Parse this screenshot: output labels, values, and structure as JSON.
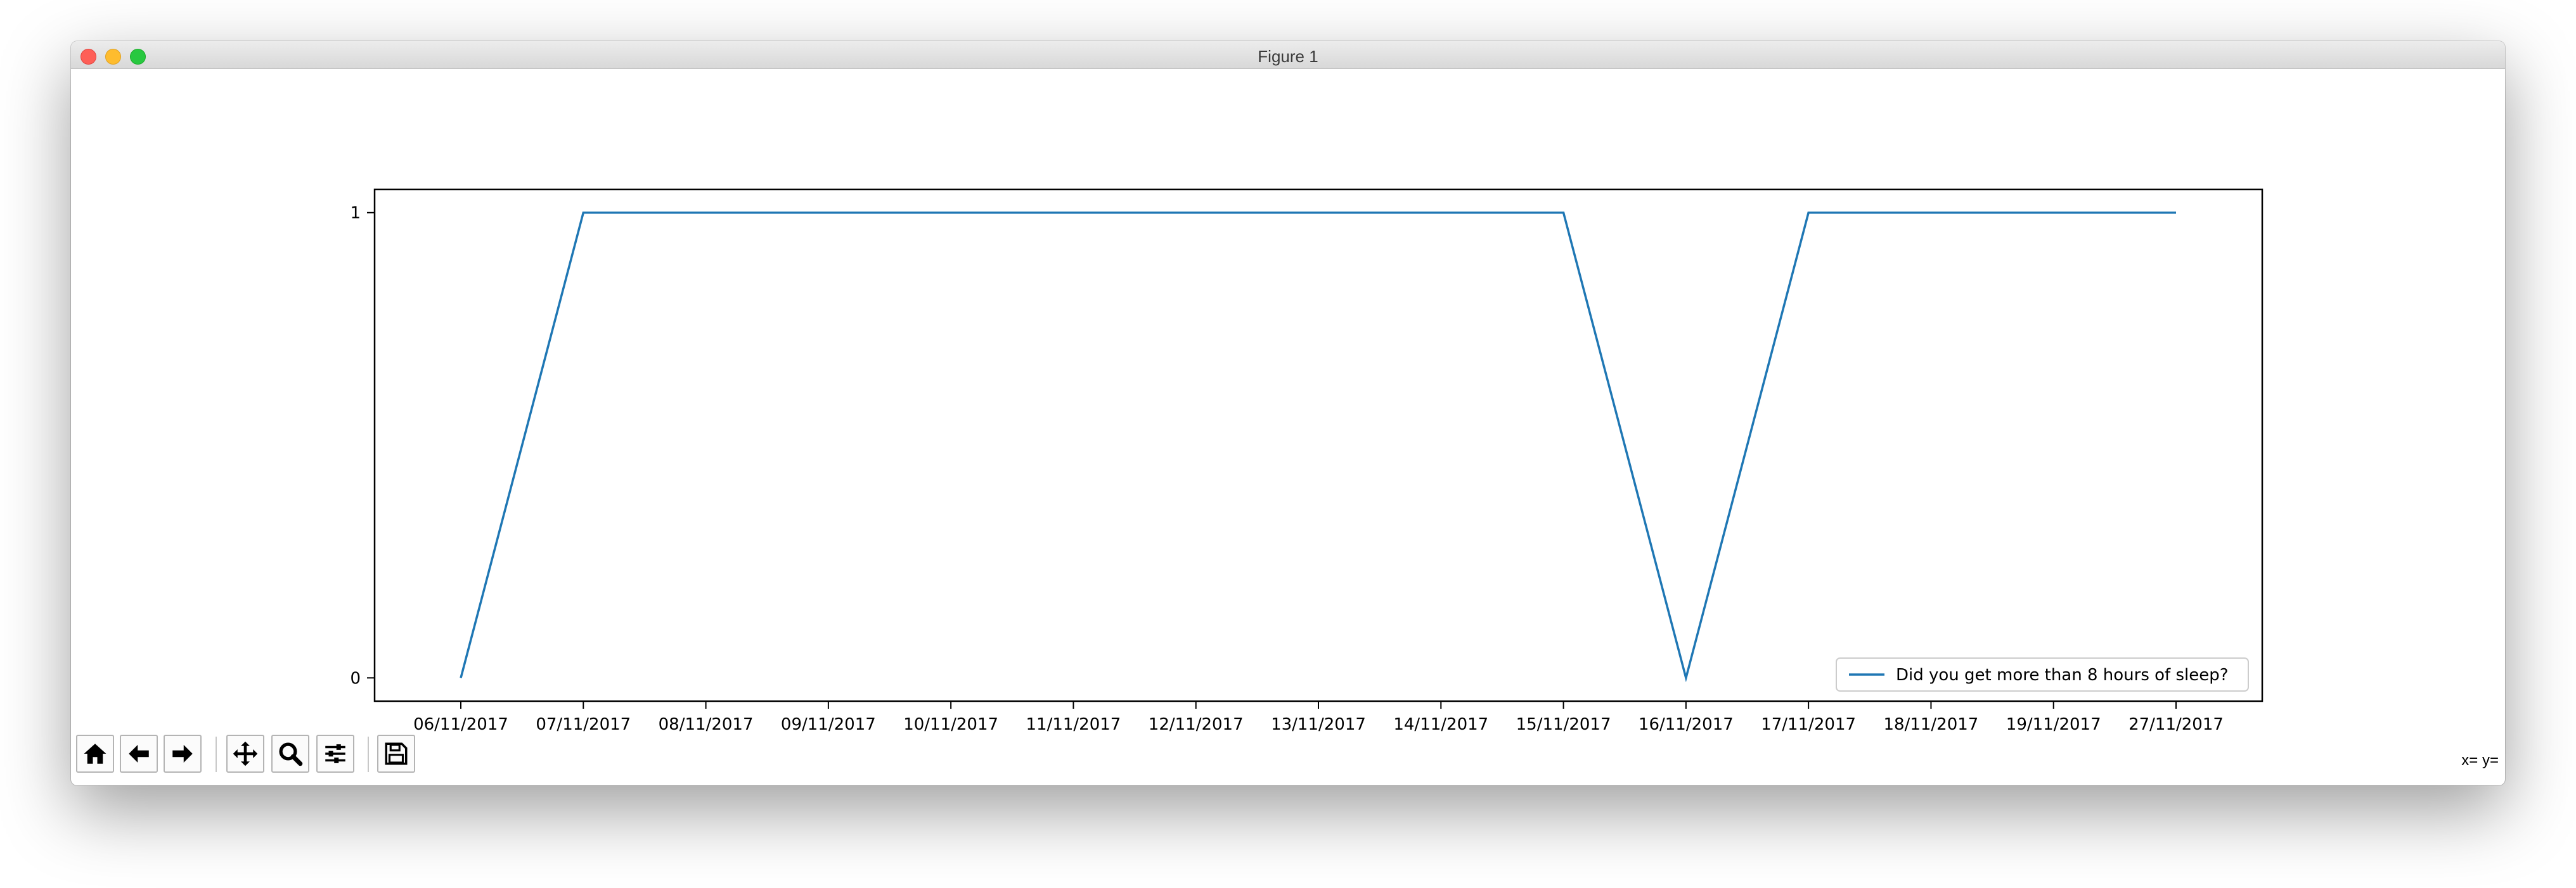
{
  "window": {
    "title": "Figure 1"
  },
  "toolbar": {
    "buttons": [
      {
        "name": "home-button",
        "icon": "home-icon"
      },
      {
        "name": "back-button",
        "icon": "arrow-left-icon"
      },
      {
        "name": "forward-button",
        "icon": "arrow-right-icon"
      },
      {
        "name": "pan-button",
        "icon": "move-icon"
      },
      {
        "name": "zoom-button",
        "icon": "search-icon"
      },
      {
        "name": "configure-subplots-button",
        "icon": "sliders-icon"
      },
      {
        "name": "save-button",
        "icon": "floppy-disk-icon"
      }
    ],
    "coords_label": "x= y="
  },
  "chart_data": {
    "type": "line",
    "categories": [
      "06/11/2017",
      "07/11/2017",
      "08/11/2017",
      "09/11/2017",
      "10/11/2017",
      "11/11/2017",
      "12/11/2017",
      "13/11/2017",
      "14/11/2017",
      "15/11/2017",
      "16/11/2017",
      "17/11/2017",
      "18/11/2017",
      "19/11/2017",
      "27/11/2017"
    ],
    "series": [
      {
        "name": "Did you get more than 8 hours of sleep?",
        "values": [
          0,
          1,
          1,
          1,
          1,
          1,
          1,
          1,
          1,
          1,
          0,
          1,
          1,
          1,
          1
        ],
        "color": "#1f77b4"
      }
    ],
    "yticks": [
      "0",
      "1"
    ],
    "ylim": [
      -0.05,
      1.05
    ],
    "title": "",
    "xlabel": "",
    "ylabel": "",
    "legend_position": "lower right",
    "grid": false
  }
}
